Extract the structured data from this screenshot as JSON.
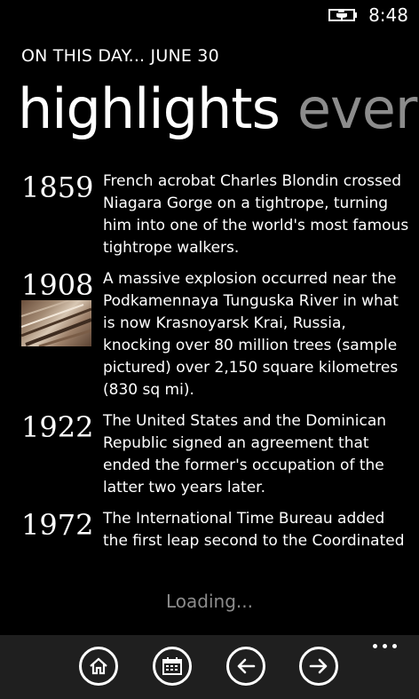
{
  "status": {
    "time": "8:48",
    "battery_icon": "battery-charging-icon"
  },
  "header": {
    "title": "ON THIS DAY... JUNE 30",
    "pivots": [
      {
        "label": "highlights",
        "active": true
      },
      {
        "label": "ever",
        "active": false
      }
    ]
  },
  "events": [
    {
      "year": "1859",
      "text": "French acrobat Charles Blondin crossed Niagara Gorge on a tightrope, turning him into one of the world's most famous tightrope walkers."
    },
    {
      "year": "1908",
      "text": "A massive explosion occurred near the Podkamennaya Tunguska River in what is now Krasnoyarsk Krai, Russia, knocking over 80 million trees (sample pictured) over 2,150 square kilometres (830 sq mi).",
      "has_image": true
    },
    {
      "year": "1922",
      "text": "The United States and the Dominican Republic signed an agreement that ended the former's occupation of the latter two years later."
    },
    {
      "year": "1972",
      "text": "The International Time Bureau added the first leap second to the Coordinated"
    }
  ],
  "loading_text": "Loading...",
  "app_bar": {
    "buttons": [
      {
        "name": "home",
        "icon": "home-icon"
      },
      {
        "name": "calendar",
        "icon": "calendar-icon"
      },
      {
        "name": "back",
        "icon": "arrow-left-icon"
      },
      {
        "name": "forward",
        "icon": "arrow-right-icon"
      }
    ],
    "more_icon": "more-icon"
  },
  "colors": {
    "background": "#000000",
    "foreground": "#ffffff",
    "inactive": "#8c8c8c",
    "app_bar": "#1f1f1f"
  }
}
